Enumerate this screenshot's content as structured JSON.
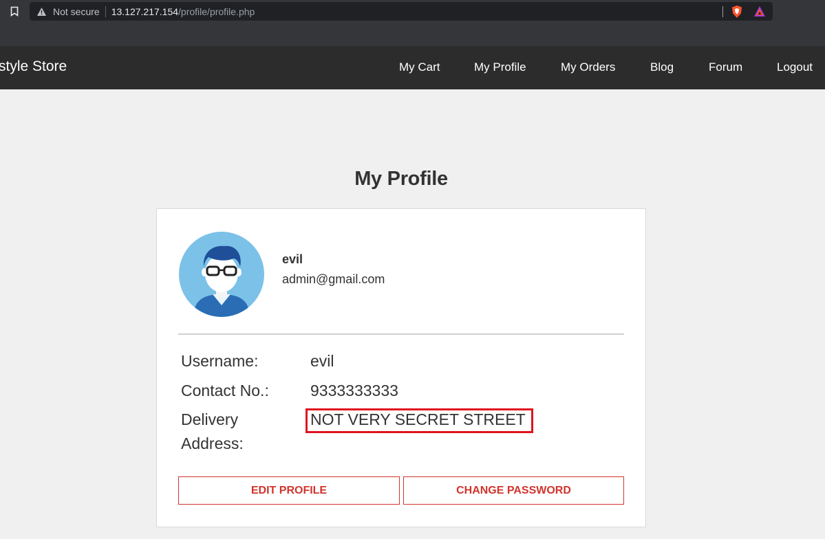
{
  "browser": {
    "security_label": "Not secure",
    "url_host": "13.127.217.154",
    "url_path": "/profile/profile.php"
  },
  "navbar": {
    "brand": "style Store",
    "items": [
      {
        "label": "My Cart"
      },
      {
        "label": "My Profile"
      },
      {
        "label": "My Orders"
      },
      {
        "label": "Blog"
      },
      {
        "label": "Forum"
      },
      {
        "label": "Logout"
      }
    ]
  },
  "profile": {
    "title": "My Profile",
    "name": "evil",
    "email": "admin@gmail.com",
    "details": [
      {
        "label": "Username:",
        "value": "evil"
      },
      {
        "label": "Contact No.:",
        "value": "9333333333"
      },
      {
        "label": "Delivery Address:",
        "value": "NOT VERY SECRET STREET"
      }
    ],
    "edit_button": "EDIT PROFILE",
    "password_button": "CHANGE PASSWORD"
  },
  "colors": {
    "navbar_bg": "#2c2c2c",
    "button_accent": "#d0342c",
    "highlight": "#e0131e"
  }
}
